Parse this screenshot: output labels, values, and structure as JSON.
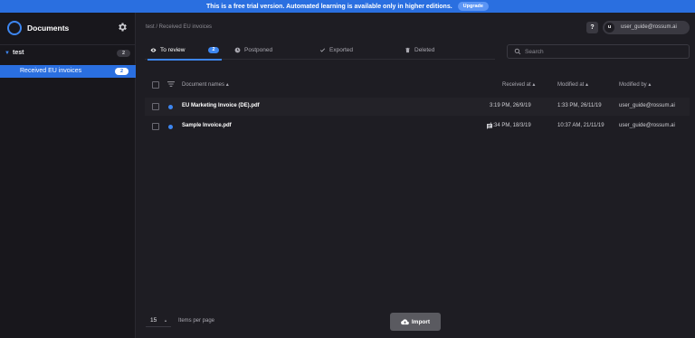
{
  "banner": {
    "text": "This is a free trial version. Automated learning is available only in higher editions.",
    "upgrade_label": "Upgrade"
  },
  "sidebar": {
    "app_title": "Documents",
    "group": {
      "name": "test",
      "count": "2"
    },
    "queue": {
      "label": "Received EU invoices",
      "count": "2"
    }
  },
  "header": {
    "breadcrumb": "test / Received EU invoices",
    "help_label": "?",
    "user_initial": "u",
    "user_email": "user_guide@rossum.ai"
  },
  "tabs": [
    {
      "label": "To review",
      "count": "2",
      "icon": "eye-icon"
    },
    {
      "label": "Postponed",
      "icon": "clock-icon"
    },
    {
      "label": "Exported",
      "icon": "check-icon"
    },
    {
      "label": "Deleted",
      "icon": "trash-icon"
    }
  ],
  "search": {
    "placeholder": "Search"
  },
  "table": {
    "columns": [
      "Document names",
      "Received at",
      "Modified at",
      "Modified by"
    ],
    "rows": [
      {
        "name": "EU Marketing Invoice (DE).pdf",
        "received": "3:19 PM, 26/9/19",
        "modified": "1:33 PM, 26/11/19",
        "modified_by": "user_guide@rossum.ai",
        "has_note": false
      },
      {
        "name": "Sample Invoice.pdf",
        "received": "1:34 PM, 18/3/19",
        "modified": "10:37 AM, 21/11/19",
        "modified_by": "user_guide@rossum.ai",
        "has_note": true
      }
    ]
  },
  "footer": {
    "per_page_value": "15",
    "per_page_label": "Items per page",
    "import_label": "Import"
  },
  "colors": {
    "accent": "#2a6fe0",
    "background": "#1e1d23",
    "sidebar": "#18171c"
  }
}
